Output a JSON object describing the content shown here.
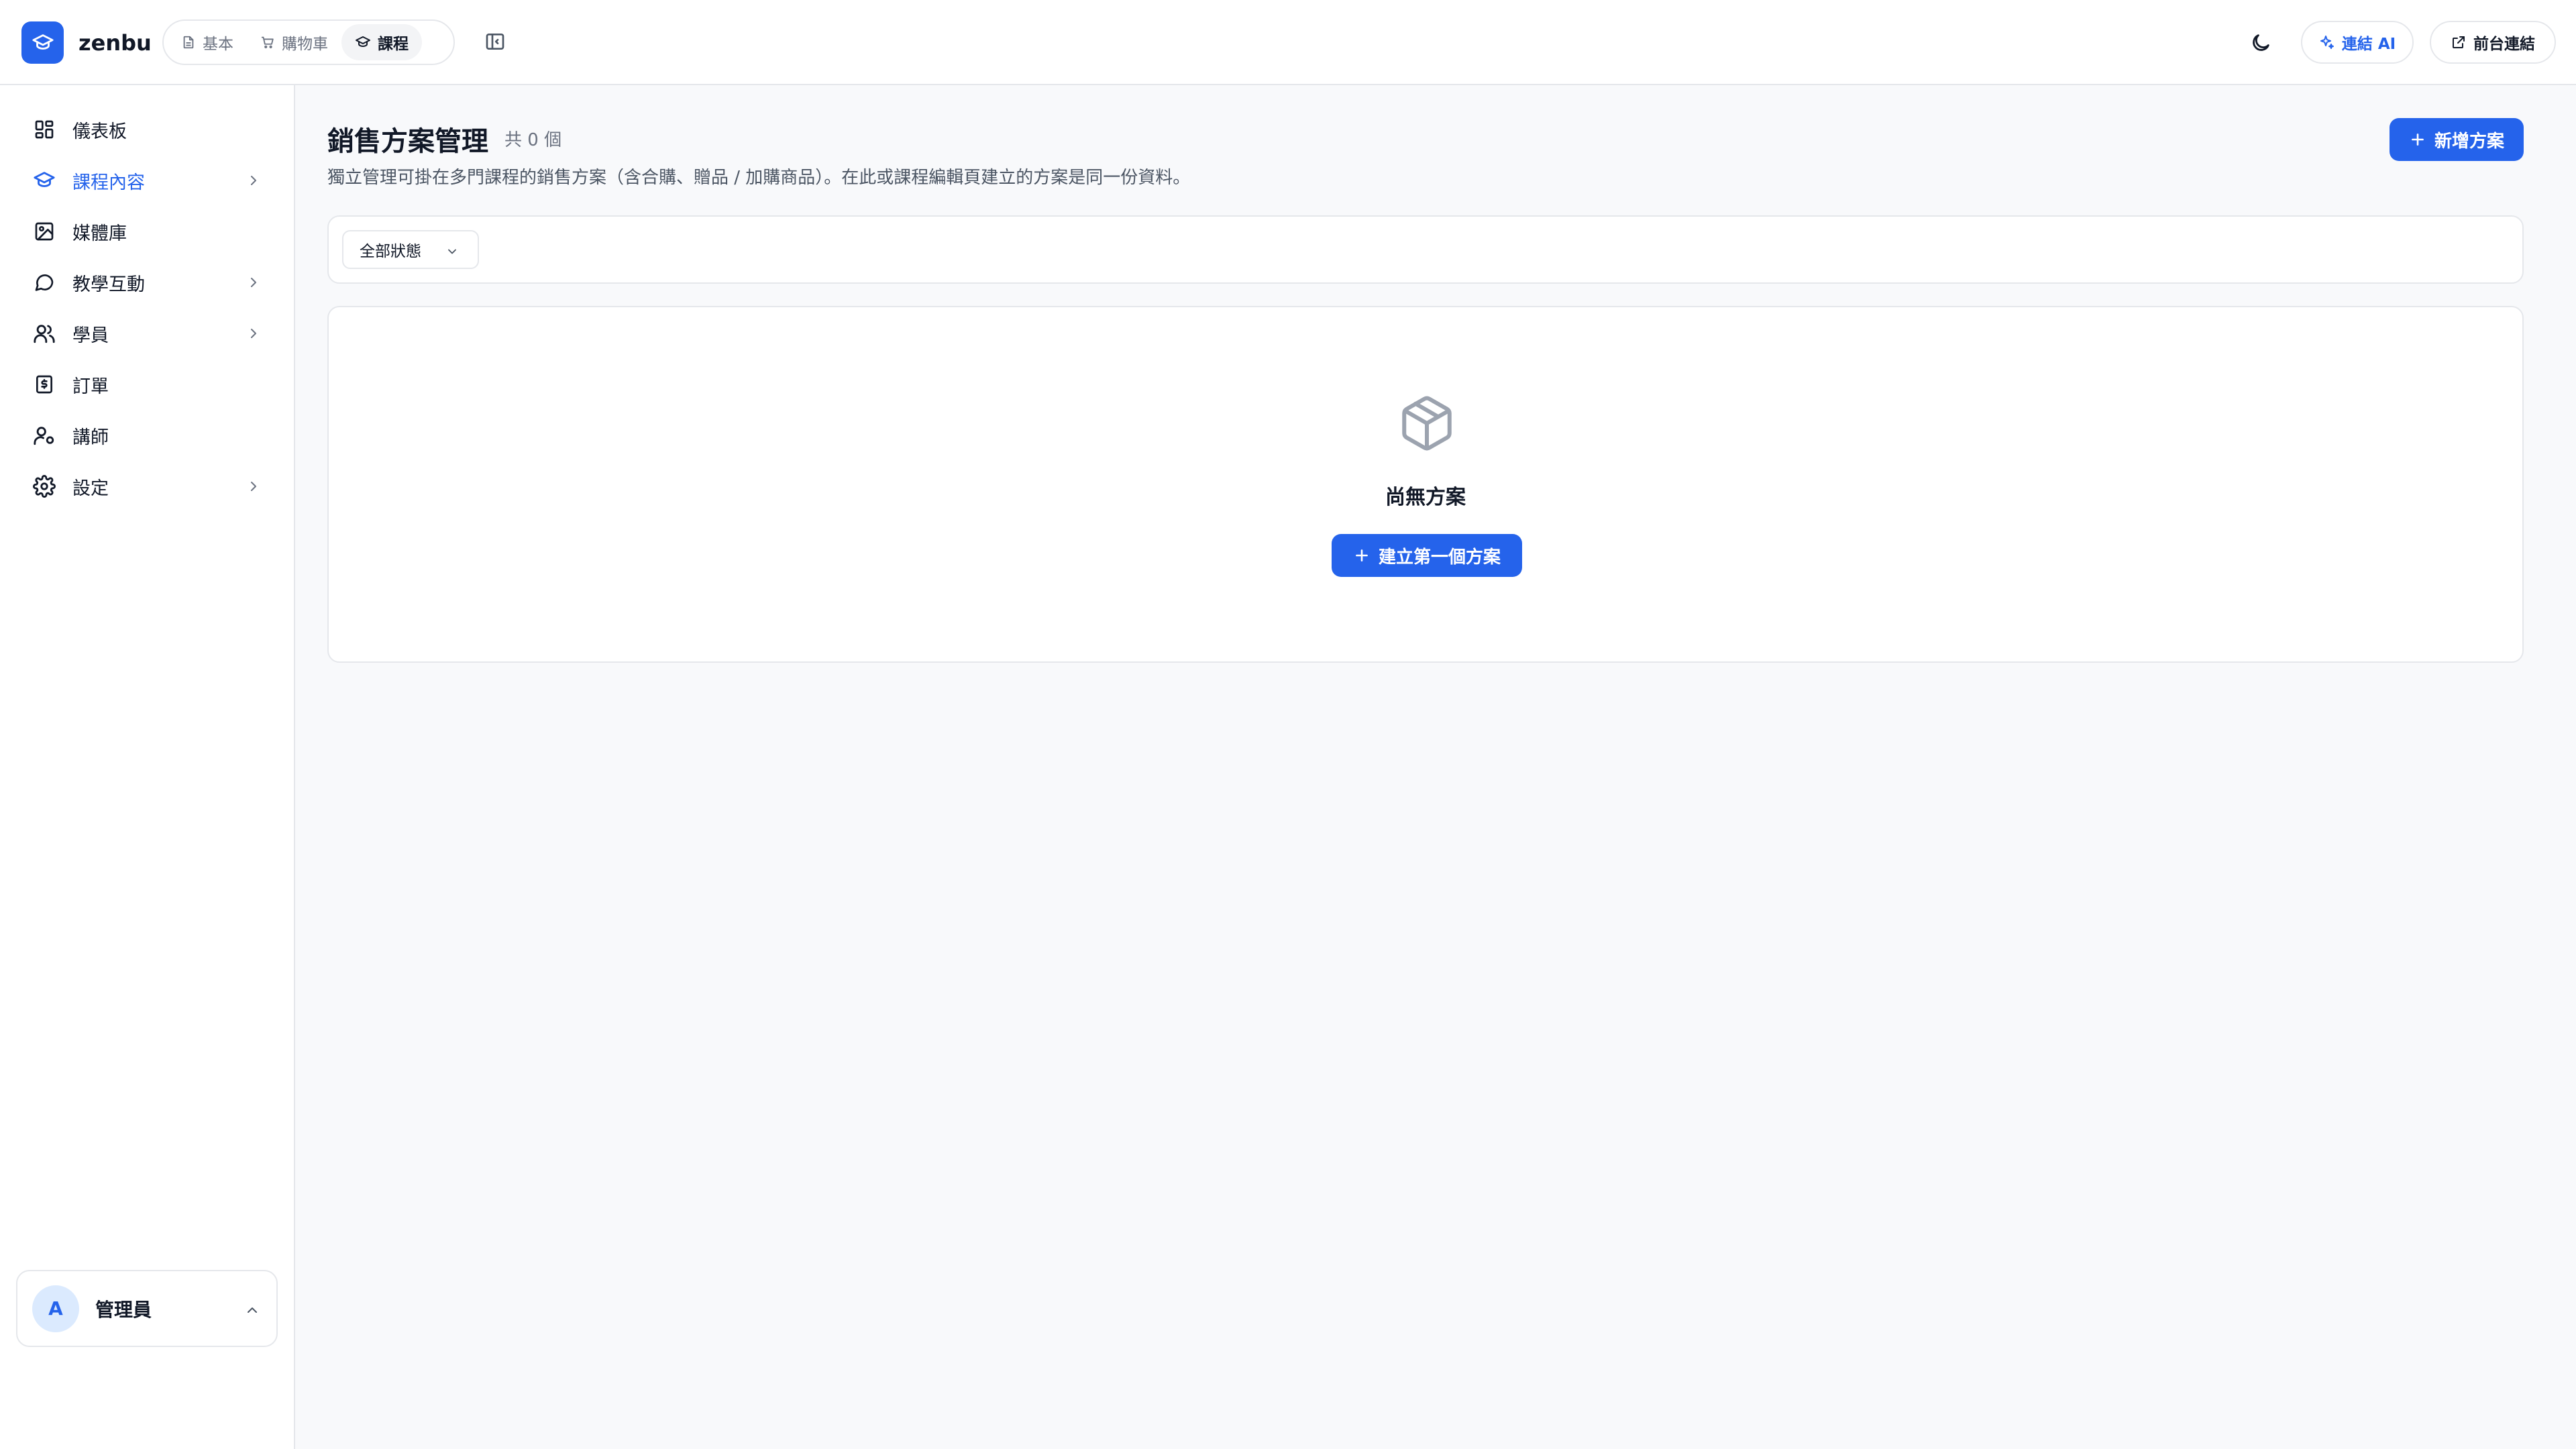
{
  "app": {
    "brand": "zenbu",
    "colors": {
      "accent": "#2563eb",
      "border": "#e5e7eb",
      "muted": "#6b7280"
    }
  },
  "topbar": {
    "tabs": [
      {
        "label": "基本",
        "icon": "document-icon",
        "active": false
      },
      {
        "label": "購物車",
        "icon": "cart-icon",
        "active": false
      },
      {
        "label": "課程",
        "icon": "graduation-cap-icon",
        "active": true
      }
    ],
    "ai_button": "連結 AI",
    "frontend_button": "前台連結"
  },
  "sidebar": {
    "items": [
      {
        "label": "儀表板",
        "icon": "dashboard-icon",
        "active": false,
        "has_children": false
      },
      {
        "label": "課程內容",
        "icon": "graduation-cap-icon",
        "active": true,
        "has_children": true
      },
      {
        "label": "媒體庫",
        "icon": "image-icon",
        "active": false,
        "has_children": false
      },
      {
        "label": "教學互動",
        "icon": "chat-bubble-icon",
        "active": false,
        "has_children": true
      },
      {
        "label": "學員",
        "icon": "users-icon",
        "active": false,
        "has_children": true
      },
      {
        "label": "訂單",
        "icon": "receipt-icon",
        "active": false,
        "has_children": false
      },
      {
        "label": "講師",
        "icon": "user-cog-icon",
        "active": false,
        "has_children": false
      },
      {
        "label": "設定",
        "icon": "gear-icon",
        "active": false,
        "has_children": true
      }
    ],
    "user": {
      "initial": "A",
      "name": "管理員"
    }
  },
  "main": {
    "title": "銷售方案管理",
    "count": "共 0 個",
    "description": "獨立管理可掛在多門課程的銷售方案（含合購、贈品 / 加購商品）。在此或課程編輯頁建立的方案是同一份資料。",
    "add_button": "新增方案",
    "filter": {
      "status_selected": "全部狀態"
    },
    "empty": {
      "icon": "package-icon",
      "text": "尚無方案",
      "create_button": "建立第一個方案"
    }
  }
}
